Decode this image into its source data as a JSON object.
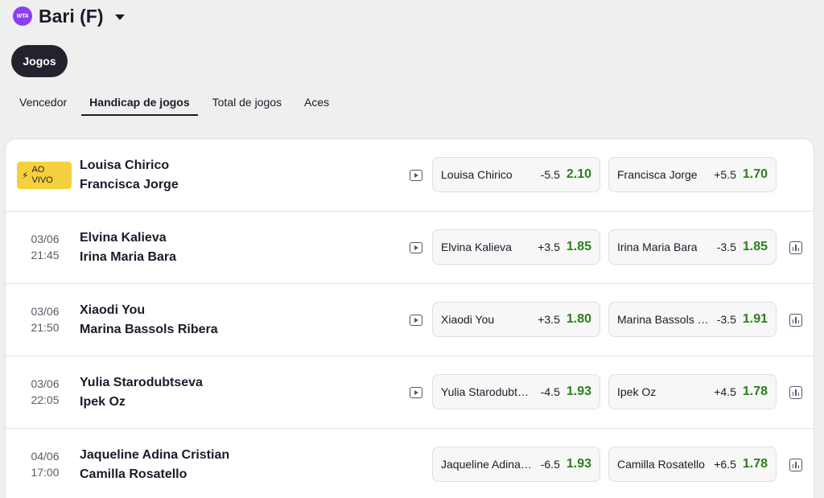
{
  "header": {
    "logo_text": "WTA",
    "title": "Bari (F)"
  },
  "filter_pill": "Jogos",
  "tabs": [
    {
      "label": "Vencedor",
      "active": false
    },
    {
      "label": "Handicap de jogos",
      "active": true
    },
    {
      "label": "Total de jogos",
      "active": false
    },
    {
      "label": "Aces",
      "active": false
    }
  ],
  "live_badge": {
    "line1": "AO",
    "line2": "VIVO"
  },
  "colors": {
    "accent_live": "#f6d13f",
    "odds_price": "#2e7d1e",
    "brand_wta": "#8a3ff2"
  },
  "matches": [
    {
      "live": true,
      "date": "",
      "time": "",
      "player1": "Louisa Chirico",
      "player2": "Francisca Jorge",
      "odd1": {
        "name": "Louisa Chirico",
        "line": "-5.5",
        "price": "2.10"
      },
      "odd2": {
        "name": "Francisca Jorge",
        "line": "+5.5",
        "price": "1.70"
      },
      "has_video": true,
      "has_stats": false
    },
    {
      "live": false,
      "date": "03/06",
      "time": "21:45",
      "player1": "Elvina Kalieva",
      "player2": "Irina Maria Bara",
      "odd1": {
        "name": "Elvina Kalieva",
        "line": "+3.5",
        "price": "1.85"
      },
      "odd2": {
        "name": "Irina Maria Bara",
        "line": "-3.5",
        "price": "1.85"
      },
      "has_video": true,
      "has_stats": true
    },
    {
      "live": false,
      "date": "03/06",
      "time": "21:50",
      "player1": "Xiaodi You",
      "player2": "Marina Bassols Ribera",
      "odd1": {
        "name": "Xiaodi You",
        "line": "+3.5",
        "price": "1.80"
      },
      "odd2": {
        "name": "Marina Bassols …",
        "line": "-3.5",
        "price": "1.91"
      },
      "has_video": true,
      "has_stats": true
    },
    {
      "live": false,
      "date": "03/06",
      "time": "22:05",
      "player1": "Yulia Starodubtseva",
      "player2": "Ipek Oz",
      "odd1": {
        "name": "Yulia Starodubt…",
        "line": "-4.5",
        "price": "1.93"
      },
      "odd2": {
        "name": "Ipek Oz",
        "line": "+4.5",
        "price": "1.78"
      },
      "has_video": true,
      "has_stats": true
    },
    {
      "live": false,
      "date": "04/06",
      "time": "17:00",
      "player1": "Jaqueline Adina Cristian",
      "player2": "Camilla Rosatello",
      "odd1": {
        "name": "Jaqueline Adina…",
        "line": "-6.5",
        "price": "1.93"
      },
      "odd2": {
        "name": "Camilla Rosatello",
        "line": "+6.5",
        "price": "1.78"
      },
      "has_video": false,
      "has_stats": true
    }
  ]
}
